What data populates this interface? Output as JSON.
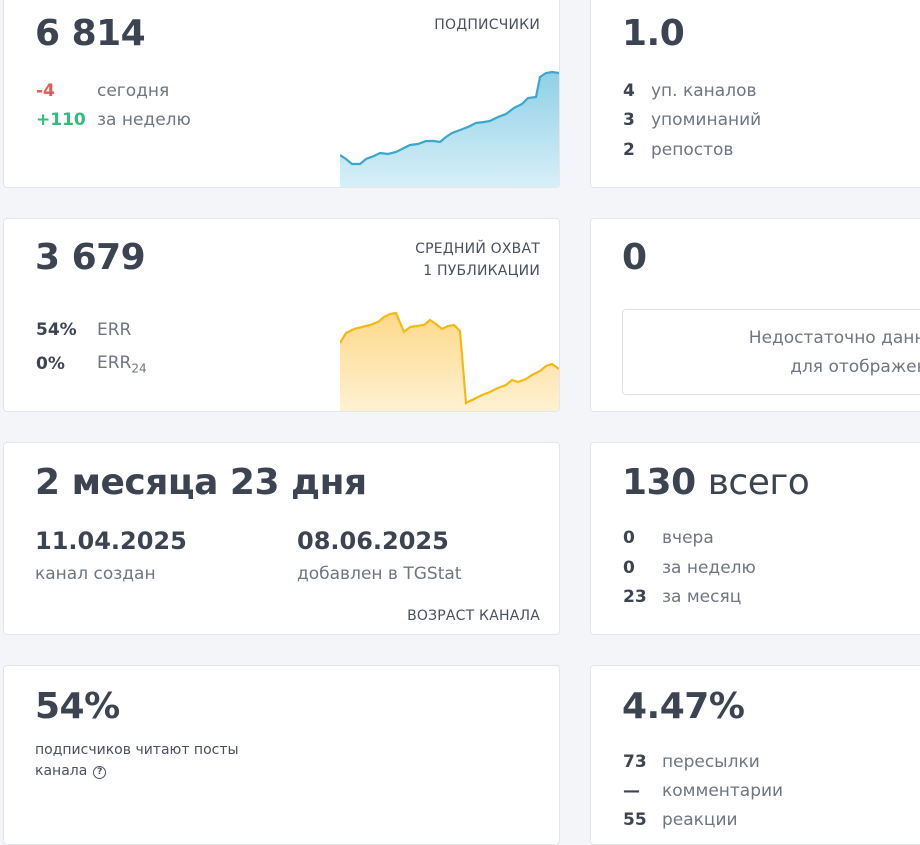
{
  "subscribers": {
    "value": "6 814",
    "caption": "ПОДПИСЧИКИ",
    "today_value": "-4",
    "today_label": "сегодня",
    "week_value": "+110",
    "week_label": "за неделю"
  },
  "citation": {
    "value": "1.0",
    "rows": [
      {
        "n": "4",
        "label": "уп. каналов"
      },
      {
        "n": "3",
        "label": "упоминаний"
      },
      {
        "n": "2",
        "label": "репостов"
      }
    ]
  },
  "reach": {
    "value": "3 679",
    "caption_line1": "СРЕДНИЙ ОХВАТ",
    "caption_line2": "1 ПУБЛИКАЦИИ",
    "err_value": "54%",
    "err_label": "ERR",
    "err24_value": "0%",
    "err24_label": "ERR",
    "err24_sub": "24"
  },
  "zero_card": {
    "value": "0",
    "nodata_line1": "Недостаточно данных",
    "nodata_line2": "для отображения"
  },
  "age": {
    "value": "2 месяца 23 дня",
    "created_date": "11.04.2025",
    "created_label": "канал создан",
    "added_date": "08.06.2025",
    "added_label": "добавлен в TGStat",
    "caption": "ВОЗРАСТ КАНАЛА"
  },
  "posts": {
    "value": "130",
    "value_suffix": "всего",
    "rows": [
      {
        "n": "0",
        "label": "вчера"
      },
      {
        "n": "0",
        "label": "за неделю"
      },
      {
        "n": "23",
        "label": "за месяц"
      }
    ]
  },
  "readers": {
    "value": "54%",
    "line1": "подписчиков читают посты",
    "line2": "канала",
    "help_icon": "question-circle-icon"
  },
  "engagement": {
    "value": "4.47%",
    "rows": [
      {
        "n": "73",
        "label": "пересылки"
      },
      {
        "n": "—",
        "label": "комментарии"
      },
      {
        "n": "55",
        "label": "реакции"
      }
    ]
  },
  "colors": {
    "negative": "#e25a57",
    "positive": "#2ebd7a",
    "subscribers_line": "#3aa8cc",
    "reach_line": "#f5b913"
  }
}
